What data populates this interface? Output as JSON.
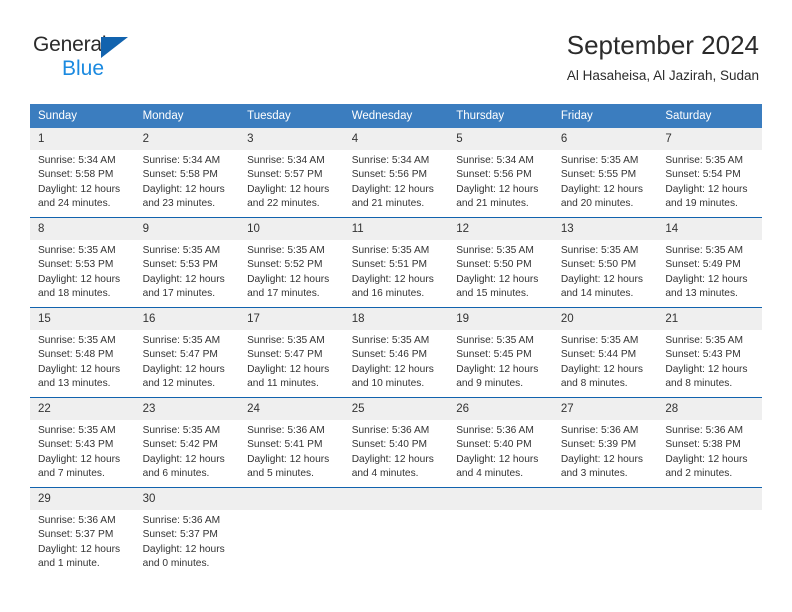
{
  "brand": {
    "name_part1": "General",
    "name_part2": "Blue",
    "triangle_color": "#1263ae",
    "blue_color": "#1b8ae0"
  },
  "header": {
    "title": "September 2024",
    "location": "Al Hasaheisa, Al Jazirah, Sudan"
  },
  "theme": {
    "header_blue": "#3b7dbf",
    "rule_blue": "#1263ae",
    "daynum_band": "#efefef",
    "text": "#333333"
  },
  "weekdays": [
    "Sunday",
    "Monday",
    "Tuesday",
    "Wednesday",
    "Thursday",
    "Friday",
    "Saturday"
  ],
  "weeks": [
    [
      {
        "day": "1",
        "sunrise": "Sunrise: 5:34 AM",
        "sunset": "Sunset: 5:58 PM",
        "daylight": "Daylight: 12 hours and 24 minutes."
      },
      {
        "day": "2",
        "sunrise": "Sunrise: 5:34 AM",
        "sunset": "Sunset: 5:58 PM",
        "daylight": "Daylight: 12 hours and 23 minutes."
      },
      {
        "day": "3",
        "sunrise": "Sunrise: 5:34 AM",
        "sunset": "Sunset: 5:57 PM",
        "daylight": "Daylight: 12 hours and 22 minutes."
      },
      {
        "day": "4",
        "sunrise": "Sunrise: 5:34 AM",
        "sunset": "Sunset: 5:56 PM",
        "daylight": "Daylight: 12 hours and 21 minutes."
      },
      {
        "day": "5",
        "sunrise": "Sunrise: 5:34 AM",
        "sunset": "Sunset: 5:56 PM",
        "daylight": "Daylight: 12 hours and 21 minutes."
      },
      {
        "day": "6",
        "sunrise": "Sunrise: 5:35 AM",
        "sunset": "Sunset: 5:55 PM",
        "daylight": "Daylight: 12 hours and 20 minutes."
      },
      {
        "day": "7",
        "sunrise": "Sunrise: 5:35 AM",
        "sunset": "Sunset: 5:54 PM",
        "daylight": "Daylight: 12 hours and 19 minutes."
      }
    ],
    [
      {
        "day": "8",
        "sunrise": "Sunrise: 5:35 AM",
        "sunset": "Sunset: 5:53 PM",
        "daylight": "Daylight: 12 hours and 18 minutes."
      },
      {
        "day": "9",
        "sunrise": "Sunrise: 5:35 AM",
        "sunset": "Sunset: 5:53 PM",
        "daylight": "Daylight: 12 hours and 17 minutes."
      },
      {
        "day": "10",
        "sunrise": "Sunrise: 5:35 AM",
        "sunset": "Sunset: 5:52 PM",
        "daylight": "Daylight: 12 hours and 17 minutes."
      },
      {
        "day": "11",
        "sunrise": "Sunrise: 5:35 AM",
        "sunset": "Sunset: 5:51 PM",
        "daylight": "Daylight: 12 hours and 16 minutes."
      },
      {
        "day": "12",
        "sunrise": "Sunrise: 5:35 AM",
        "sunset": "Sunset: 5:50 PM",
        "daylight": "Daylight: 12 hours and 15 minutes."
      },
      {
        "day": "13",
        "sunrise": "Sunrise: 5:35 AM",
        "sunset": "Sunset: 5:50 PM",
        "daylight": "Daylight: 12 hours and 14 minutes."
      },
      {
        "day": "14",
        "sunrise": "Sunrise: 5:35 AM",
        "sunset": "Sunset: 5:49 PM",
        "daylight": "Daylight: 12 hours and 13 minutes."
      }
    ],
    [
      {
        "day": "15",
        "sunrise": "Sunrise: 5:35 AM",
        "sunset": "Sunset: 5:48 PM",
        "daylight": "Daylight: 12 hours and 13 minutes."
      },
      {
        "day": "16",
        "sunrise": "Sunrise: 5:35 AM",
        "sunset": "Sunset: 5:47 PM",
        "daylight": "Daylight: 12 hours and 12 minutes."
      },
      {
        "day": "17",
        "sunrise": "Sunrise: 5:35 AM",
        "sunset": "Sunset: 5:47 PM",
        "daylight": "Daylight: 12 hours and 11 minutes."
      },
      {
        "day": "18",
        "sunrise": "Sunrise: 5:35 AM",
        "sunset": "Sunset: 5:46 PM",
        "daylight": "Daylight: 12 hours and 10 minutes."
      },
      {
        "day": "19",
        "sunrise": "Sunrise: 5:35 AM",
        "sunset": "Sunset: 5:45 PM",
        "daylight": "Daylight: 12 hours and 9 minutes."
      },
      {
        "day": "20",
        "sunrise": "Sunrise: 5:35 AM",
        "sunset": "Sunset: 5:44 PM",
        "daylight": "Daylight: 12 hours and 8 minutes."
      },
      {
        "day": "21",
        "sunrise": "Sunrise: 5:35 AM",
        "sunset": "Sunset: 5:43 PM",
        "daylight": "Daylight: 12 hours and 8 minutes."
      }
    ],
    [
      {
        "day": "22",
        "sunrise": "Sunrise: 5:35 AM",
        "sunset": "Sunset: 5:43 PM",
        "daylight": "Daylight: 12 hours and 7 minutes."
      },
      {
        "day": "23",
        "sunrise": "Sunrise: 5:35 AM",
        "sunset": "Sunset: 5:42 PM",
        "daylight": "Daylight: 12 hours and 6 minutes."
      },
      {
        "day": "24",
        "sunrise": "Sunrise: 5:36 AM",
        "sunset": "Sunset: 5:41 PM",
        "daylight": "Daylight: 12 hours and 5 minutes."
      },
      {
        "day": "25",
        "sunrise": "Sunrise: 5:36 AM",
        "sunset": "Sunset: 5:40 PM",
        "daylight": "Daylight: 12 hours and 4 minutes."
      },
      {
        "day": "26",
        "sunrise": "Sunrise: 5:36 AM",
        "sunset": "Sunset: 5:40 PM",
        "daylight": "Daylight: 12 hours and 4 minutes."
      },
      {
        "day": "27",
        "sunrise": "Sunrise: 5:36 AM",
        "sunset": "Sunset: 5:39 PM",
        "daylight": "Daylight: 12 hours and 3 minutes."
      },
      {
        "day": "28",
        "sunrise": "Sunrise: 5:36 AM",
        "sunset": "Sunset: 5:38 PM",
        "daylight": "Daylight: 12 hours and 2 minutes."
      }
    ],
    [
      {
        "day": "29",
        "sunrise": "Sunrise: 5:36 AM",
        "sunset": "Sunset: 5:37 PM",
        "daylight": "Daylight: 12 hours and 1 minute."
      },
      {
        "day": "30",
        "sunrise": "Sunrise: 5:36 AM",
        "sunset": "Sunset: 5:37 PM",
        "daylight": "Daylight: 12 hours and 0 minutes."
      },
      {
        "day": "",
        "sunrise": "",
        "sunset": "",
        "daylight": ""
      },
      {
        "day": "",
        "sunrise": "",
        "sunset": "",
        "daylight": ""
      },
      {
        "day": "",
        "sunrise": "",
        "sunset": "",
        "daylight": ""
      },
      {
        "day": "",
        "sunrise": "",
        "sunset": "",
        "daylight": ""
      },
      {
        "day": "",
        "sunrise": "",
        "sunset": "",
        "daylight": ""
      }
    ]
  ]
}
